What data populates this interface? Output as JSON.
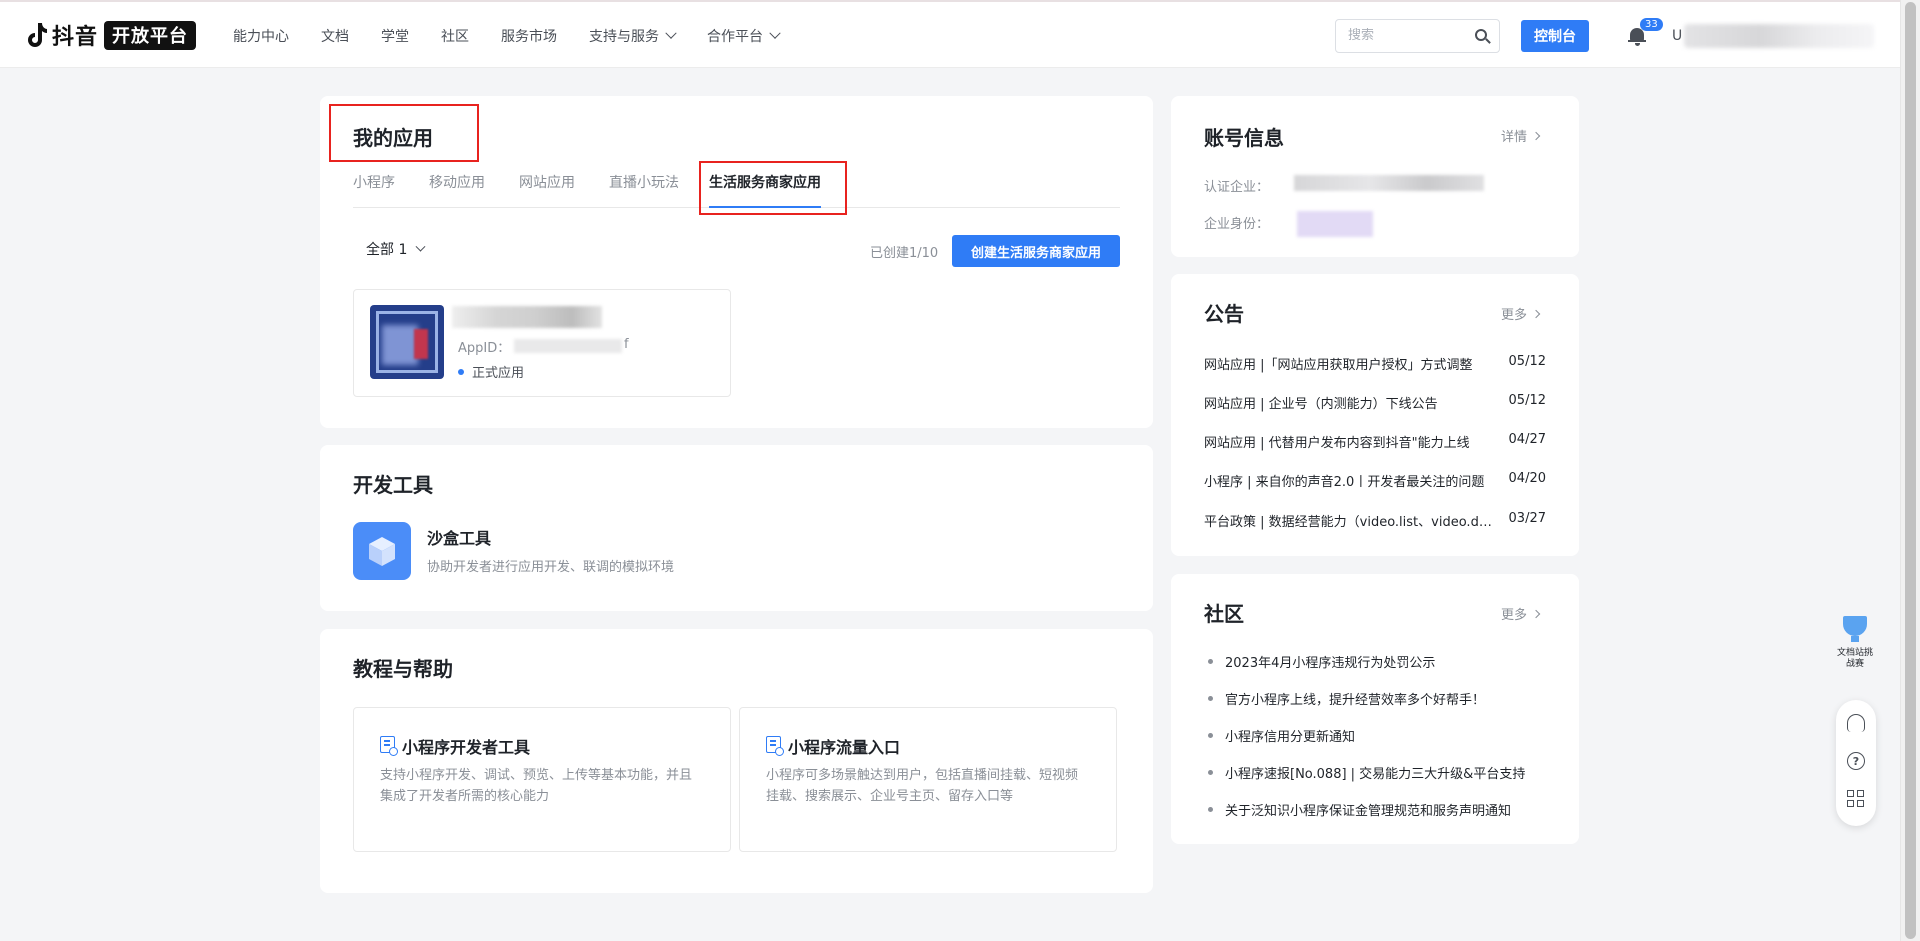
{
  "nav": {
    "logo_text": "抖音",
    "logo_badge": "开放平台",
    "items": [
      {
        "label": "能力中心"
      },
      {
        "label": "文档"
      },
      {
        "label": "学堂"
      },
      {
        "label": "社区"
      },
      {
        "label": "服务市场"
      },
      {
        "label": "支持与服务",
        "dropdown": true
      },
      {
        "label": "合作平台",
        "dropdown": true
      }
    ],
    "search_placeholder": "搜索",
    "console_button": "控制台",
    "notification_count": "33",
    "user_initial": "U"
  },
  "my_apps": {
    "title": "我的应用",
    "tabs": [
      "小程序",
      "移动应用",
      "网站应用",
      "直播小玩法",
      "生活服务商家应用"
    ],
    "active_tab": "生活服务商家应用",
    "filter_label": "全部 1",
    "created_count": "已创建1/10",
    "create_button": "创建生活服务商家应用",
    "app": {
      "appid_label": "AppID：",
      "appid_tail": "f",
      "status": "正式应用"
    }
  },
  "dev_tools": {
    "title": "开发工具",
    "tool_name": "沙盒工具",
    "tool_desc": "协助开发者进行应用开发、联调的模拟环境"
  },
  "tutorials": {
    "title": "教程与帮助",
    "cards": [
      {
        "title": "小程序开发者工具",
        "desc": "支持小程序开发、调试、预览、上传等基本功能，并且集成了开发者所需的核心能力"
      },
      {
        "title": "小程序流量入口",
        "desc": "小程序可多场景触达到用户，包括直播间挂载、短视频挂载、搜索展示、企业号主页、留存入口等"
      }
    ]
  },
  "account": {
    "title": "账号信息",
    "detail_link": "详情",
    "corp_label": "认证企业：",
    "role_label": "企业身份："
  },
  "notices": {
    "title": "公告",
    "more_link": "更多",
    "items": [
      {
        "text": "网站应用 |「网站应用获取用户授权」方式调整",
        "date": "05/12"
      },
      {
        "text": "网站应用 | 企业号（内测能力）下线公告",
        "date": "05/12"
      },
      {
        "text": "网站应用 | 代替用户发布内容到抖音\"能力上线",
        "date": "04/27"
      },
      {
        "text": "小程序 | 来自你的声音2.0丨开发者最关注的问题",
        "date": "04/20"
      },
      {
        "text": "平台政策 | 数据经营能力（video.list、video.data",
        "date": "03/27"
      }
    ]
  },
  "community": {
    "title": "社区",
    "more_link": "更多",
    "items": [
      "2023年4月小程序违规行为处罚公示",
      "官方小程序上线，提升经营效率多个好帮手！",
      "小程序信用分更新通知",
      "小程序速报[No.088] | 交易能力三大升级&平台支持",
      "关于泛知识小程序保证金管理规范和服务声明通知"
    ]
  },
  "widgets": {
    "trophy_text": "文档站挑战赛",
    "help_glyph": "?"
  },
  "colors": {
    "accent": "#2f7cf6",
    "highlight_box": "#e8231f",
    "page_bg": "#f4f5f7"
  }
}
